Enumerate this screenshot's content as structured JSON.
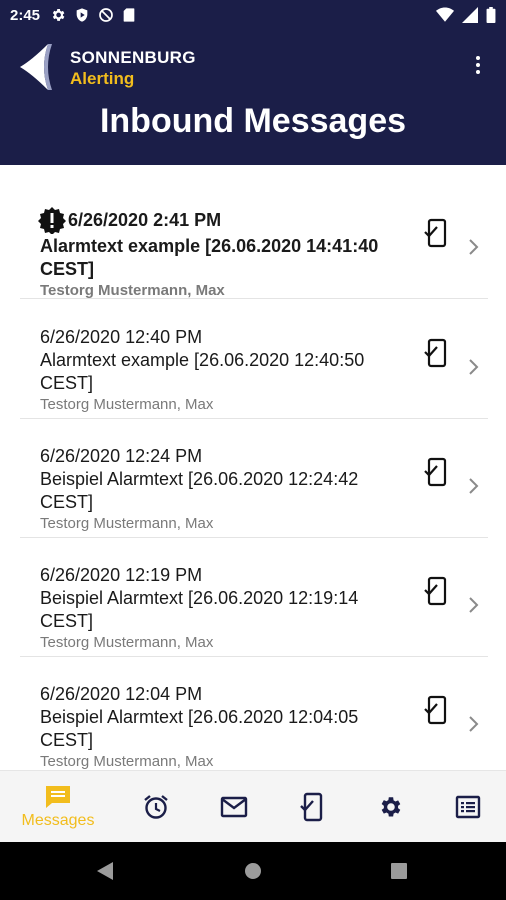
{
  "status_bar": {
    "time": "2:45",
    "left_icons": [
      "gear-icon",
      "play-protect-icon",
      "no-disturb-icon",
      "sd-card-icon"
    ],
    "right_icons": [
      "wifi-icon",
      "signal-icon",
      "battery-icon"
    ]
  },
  "header": {
    "brand_name": "SONNENBURG",
    "brand_sub": "Alerting",
    "title": "Inbound Messages"
  },
  "messages": [
    {
      "datetime": "6/26/2020 2:41 PM",
      "text": "Alarmtext example [26.06.2020 14:41:40 CEST]",
      "sender": "Testorg Mustermann, Max",
      "unread": true,
      "priority_icon": "alert-badge-icon"
    },
    {
      "datetime": "6/26/2020 12:40 PM",
      "text": "Alarmtext example [26.06.2020 12:40:50 CEST]",
      "sender": "Testorg Mustermann, Max",
      "unread": false
    },
    {
      "datetime": "6/26/2020 12:24 PM",
      "text": "Beispiel Alarmtext [26.06.2020 12:24:42 CEST]",
      "sender": "Testorg Mustermann, Max",
      "unread": false
    },
    {
      "datetime": "6/26/2020 12:19 PM",
      "text": "Beispiel Alarmtext [26.06.2020 12:19:14 CEST]",
      "sender": "Testorg Mustermann, Max",
      "unread": false
    },
    {
      "datetime": "6/26/2020 12:04 PM",
      "text": "Beispiel Alarmtext [26.06.2020 12:04:05 CEST]",
      "sender": "Testorg Mustermann, Max",
      "unread": false
    }
  ],
  "bottom_nav": {
    "items": [
      {
        "icon": "messages-icon",
        "label": "Messages",
        "active": true
      },
      {
        "icon": "alarm-clock-icon",
        "label": "",
        "active": false
      },
      {
        "icon": "mail-icon",
        "label": "",
        "active": false
      },
      {
        "icon": "phone-check-icon",
        "label": "",
        "active": false
      },
      {
        "icon": "settings-icon",
        "label": "",
        "active": false
      },
      {
        "icon": "list-icon",
        "label": "",
        "active": false
      }
    ]
  },
  "colors": {
    "header_bg": "#1b1e48",
    "accent": "#f2bd1d",
    "nav_icon": "#1b1e48"
  }
}
